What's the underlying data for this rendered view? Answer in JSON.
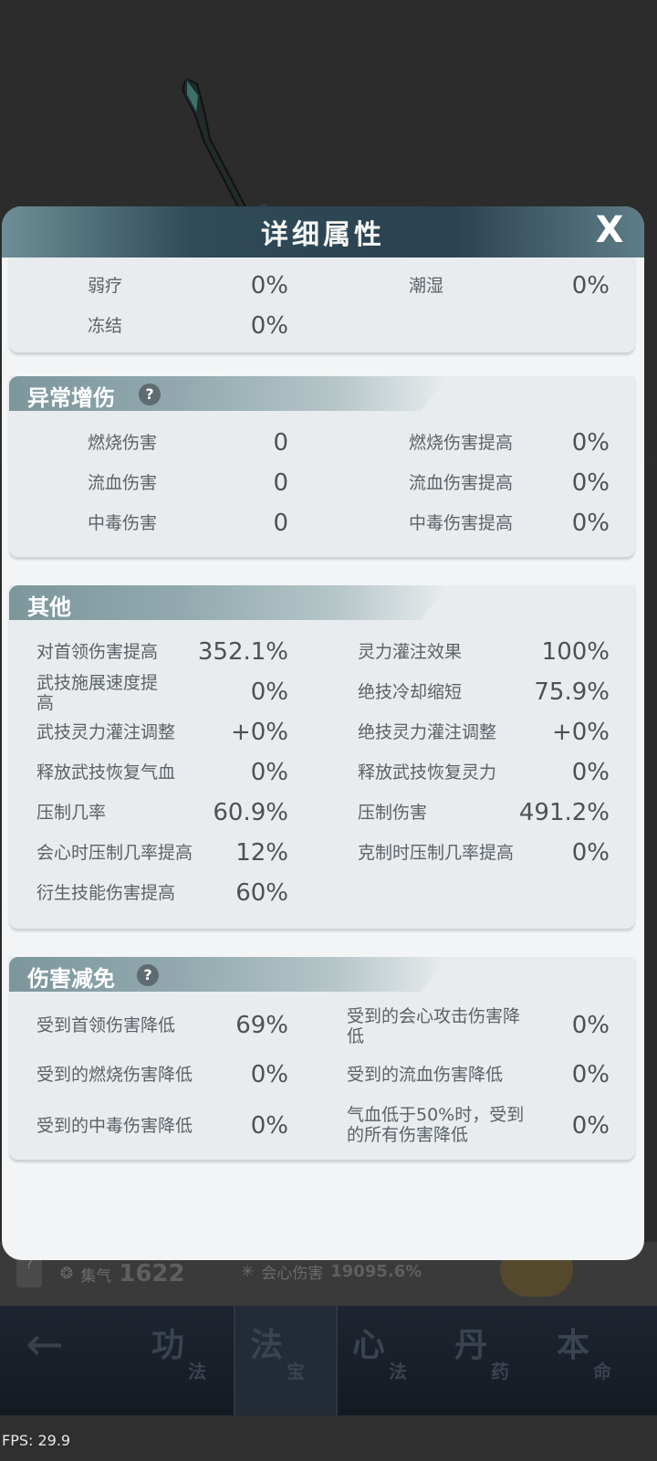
{
  "dialog": {
    "title": "详细属性",
    "close_label": "X"
  },
  "top_section": {
    "rows": [
      {
        "left_label": "弱疗",
        "left_value": "0%",
        "right_label": "潮湿",
        "right_value": "0%"
      },
      {
        "left_label": "冻结",
        "left_value": "0%"
      }
    ]
  },
  "abnormal": {
    "title": "异常增伤",
    "help": "?",
    "rows": [
      {
        "left_label": "燃烧伤害",
        "left_value": "0",
        "right_label": "燃烧伤害提高",
        "right_value": "0%"
      },
      {
        "left_label": "流血伤害",
        "left_value": "0",
        "right_label": "流血伤害提高",
        "right_value": "0%"
      },
      {
        "left_label": "中毒伤害",
        "left_value": "0",
        "right_label": "中毒伤害提高",
        "right_value": "0%"
      }
    ]
  },
  "other": {
    "title": "其他",
    "rows": [
      {
        "left_label": "对首领伤害提高",
        "left_value": "352.1%",
        "right_label": "灵力灌注效果",
        "right_value": "100%"
      },
      {
        "left_label": "武技施展速度提高",
        "left_value": "0%",
        "right_label": "绝技冷却缩短",
        "right_value": "75.9%"
      },
      {
        "left_label": "武技灵力灌注调整",
        "left_value": "+0%",
        "right_label": "绝技灵力灌注调整",
        "right_value": "+0%"
      },
      {
        "left_label": "释放武技恢复气血",
        "left_value": "0%",
        "right_label": "释放武技恢复灵力",
        "right_value": "0%"
      },
      {
        "left_label": "压制几率",
        "left_value": "60.9%",
        "right_label": "压制伤害",
        "right_value": "491.2%"
      },
      {
        "left_label": "会心时压制几率提高",
        "left_value": "12%",
        "right_label": "克制时压制几率提高",
        "right_value": "0%"
      },
      {
        "left_label": "衍生技能伤害提高",
        "left_value": "60%"
      }
    ]
  },
  "reduction": {
    "title": "伤害减免",
    "help": "?",
    "rows": [
      {
        "left_label": "受到首领伤害降低",
        "left_value": "69%",
        "right_label": "受到的会心攻击伤害降低",
        "right_value": "0%"
      },
      {
        "left_label": "受到的燃烧伤害降低",
        "left_value": "0%",
        "right_label": "受到的流血伤害降低",
        "right_value": "0%"
      },
      {
        "left_label": "受到的中毒伤害降低",
        "left_value": "0%",
        "right_label": "气血低于50%时，受到的所有伤害降低",
        "right_value": "0%"
      }
    ]
  },
  "under_strip": {
    "help": "?",
    "qi_label": "集气",
    "qi_value": "1622",
    "crit_label": "会心伤害",
    "crit_value": "19095.6%"
  },
  "nav": {
    "back_icon": "left-arrow-icon",
    "items": [
      {
        "big": "功",
        "small": "法"
      },
      {
        "big": "法",
        "small": "宝"
      },
      {
        "big": "心",
        "small": "法"
      },
      {
        "big": "丹",
        "small": "药"
      },
      {
        "big": "本",
        "small": "命"
      }
    ]
  },
  "fps": "FPS: 29.9"
}
